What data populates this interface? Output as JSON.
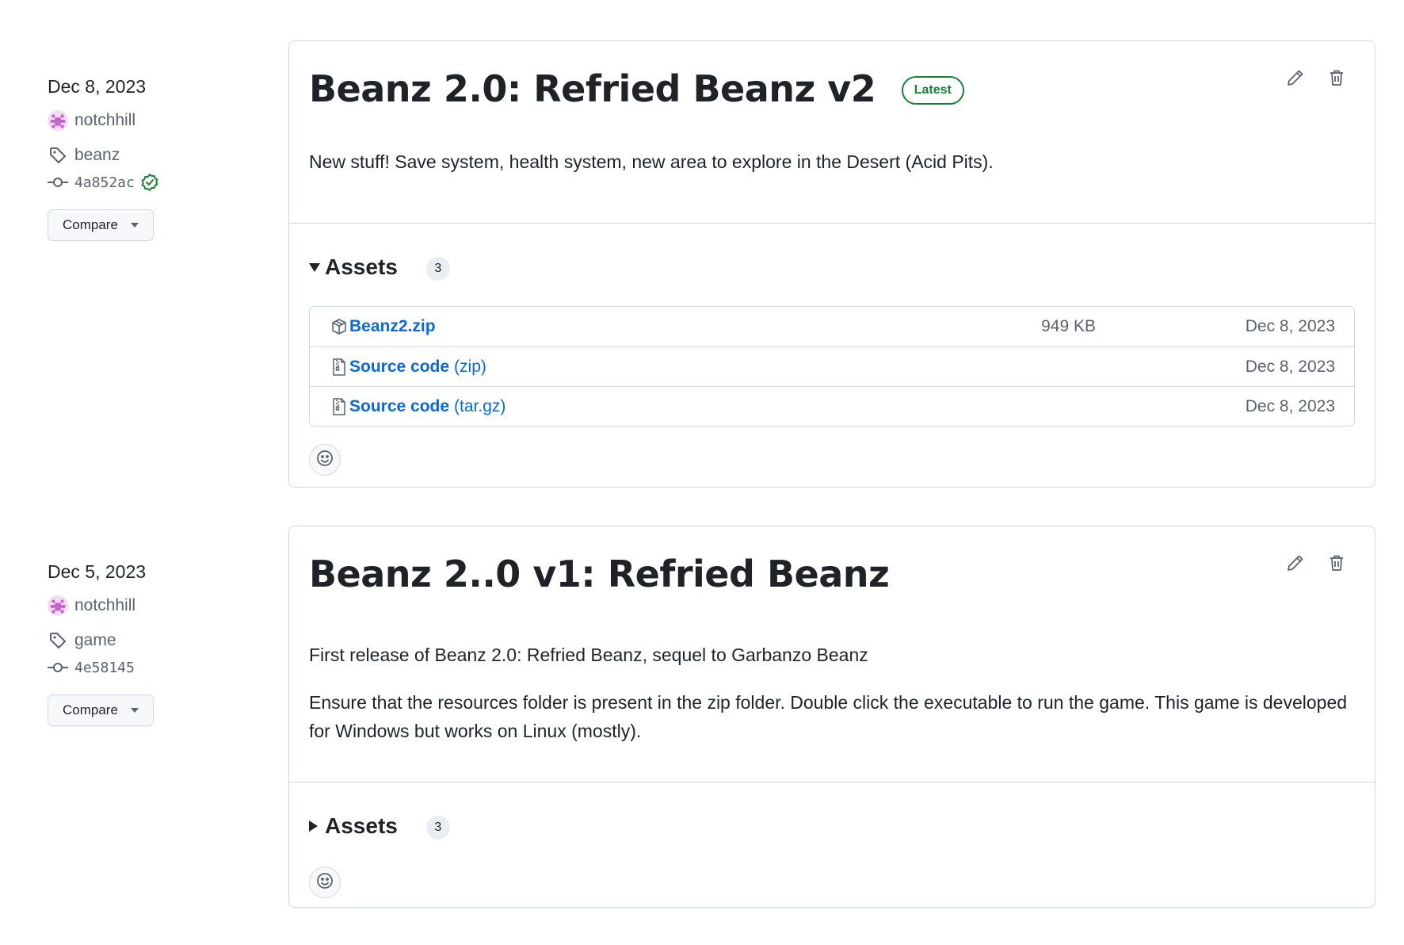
{
  "releases": [
    {
      "date": "Dec 8, 2023",
      "author": "notchhill",
      "tag": "beanz",
      "commit": "4a852ac",
      "verified": true,
      "compare_label": "Compare",
      "title": "Beanz 2.0: Refried Beanz v2",
      "latest_label": "Latest",
      "body": [
        "New stuff! Save system, health system, new area to explore in the Desert (Acid Pits)."
      ],
      "assets_label": "Assets",
      "assets_count": "3",
      "assets_expanded": true,
      "assets": [
        {
          "icon": "package-icon",
          "name": "Beanz2.zip",
          "suffix": "",
          "size": "949 KB",
          "date": "Dec 8, 2023"
        },
        {
          "icon": "file-zip-icon",
          "name": "Source code",
          "suffix": "(zip)",
          "size": "",
          "date": "Dec 8, 2023"
        },
        {
          "icon": "file-zip-icon",
          "name": "Source code",
          "suffix": "(tar.gz)",
          "size": "",
          "date": "Dec 8, 2023"
        }
      ]
    },
    {
      "date": "Dec 5, 2023",
      "author": "notchhill",
      "tag": "game",
      "commit": "4e58145",
      "verified": false,
      "compare_label": "Compare",
      "title": "Beanz 2..0 v1: Refried Beanz",
      "body": [
        "First release of Beanz 2.0: Refried Beanz, sequel to Garbanzo Beanz",
        "Ensure that the resources folder is present in the zip folder. Double click the executable to run the game. This game is developed for Windows but works on Linux (mostly)."
      ],
      "assets_label": "Assets",
      "assets_count": "3",
      "assets_expanded": false
    }
  ],
  "colors": {
    "link": "#0969da",
    "latest": "#1a7f37",
    "muted": "#59636e",
    "border": "#d1d9e0"
  }
}
